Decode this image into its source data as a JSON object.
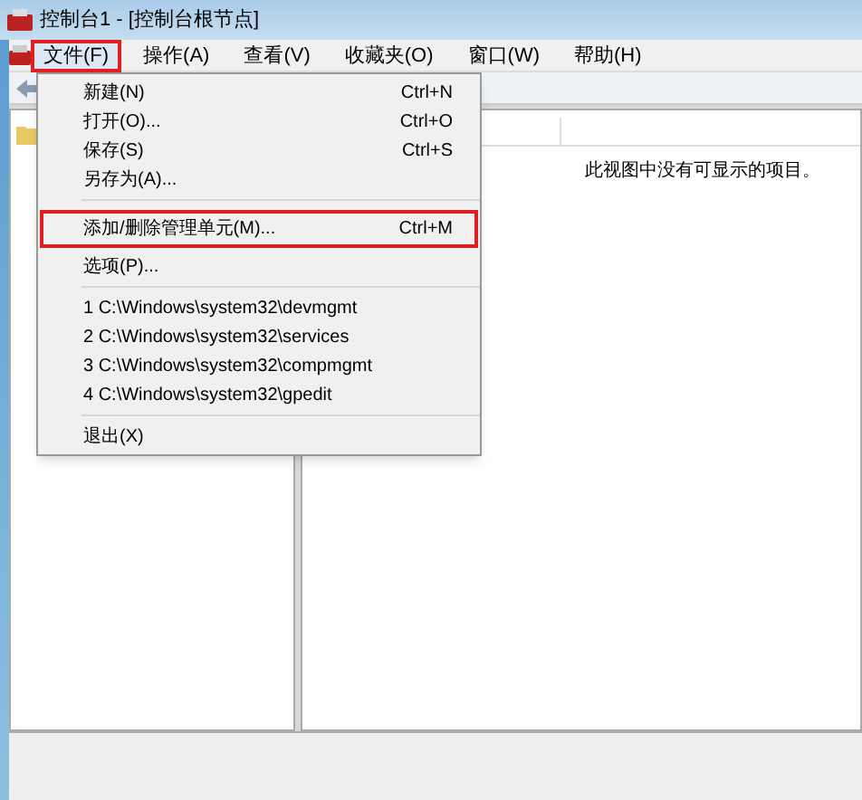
{
  "window": {
    "title": "控制台1 - [控制台根节点]"
  },
  "menu_bar": [
    {
      "label": "文件(F)",
      "selected": true,
      "highlighted": true
    },
    {
      "label": "操作(A)",
      "selected": false,
      "highlighted": false
    },
    {
      "label": "查看(V)",
      "selected": false,
      "highlighted": false
    },
    {
      "label": "收藏夹(O)",
      "selected": false,
      "highlighted": false
    },
    {
      "label": "窗口(W)",
      "selected": false,
      "highlighted": false
    },
    {
      "label": "帮助(H)",
      "selected": false,
      "highlighted": false
    }
  ],
  "file_menu": [
    {
      "kind": "item",
      "label": "新建(N)",
      "shortcut": "Ctrl+N",
      "highlighted": false
    },
    {
      "kind": "item",
      "label": "打开(O)...",
      "shortcut": "Ctrl+O",
      "highlighted": false
    },
    {
      "kind": "item",
      "label": "保存(S)",
      "shortcut": "Ctrl+S",
      "highlighted": false
    },
    {
      "kind": "item",
      "label": "另存为(A)...",
      "highlighted": false
    },
    {
      "kind": "separator"
    },
    {
      "kind": "item",
      "label": "添加/删除管理单元(M)...",
      "shortcut": "Ctrl+M",
      "highlighted": true
    },
    {
      "kind": "item",
      "label": "选项(P)...",
      "highlighted": false
    },
    {
      "kind": "separator"
    },
    {
      "kind": "item",
      "label": "1 C:\\Windows\\system32\\devmgmt",
      "highlighted": false
    },
    {
      "kind": "item",
      "label": "2 C:\\Windows\\system32\\services",
      "highlighted": false
    },
    {
      "kind": "item",
      "label": "3 C:\\Windows\\system32\\compmgmt",
      "highlighted": false
    },
    {
      "kind": "item",
      "label": "4 C:\\Windows\\system32\\gpedit",
      "highlighted": false
    },
    {
      "kind": "separator"
    },
    {
      "kind": "item",
      "label": "退出(X)",
      "highlighted": false
    }
  ],
  "results_pane": {
    "empty_message": "此视图中没有可显示的项目。"
  }
}
